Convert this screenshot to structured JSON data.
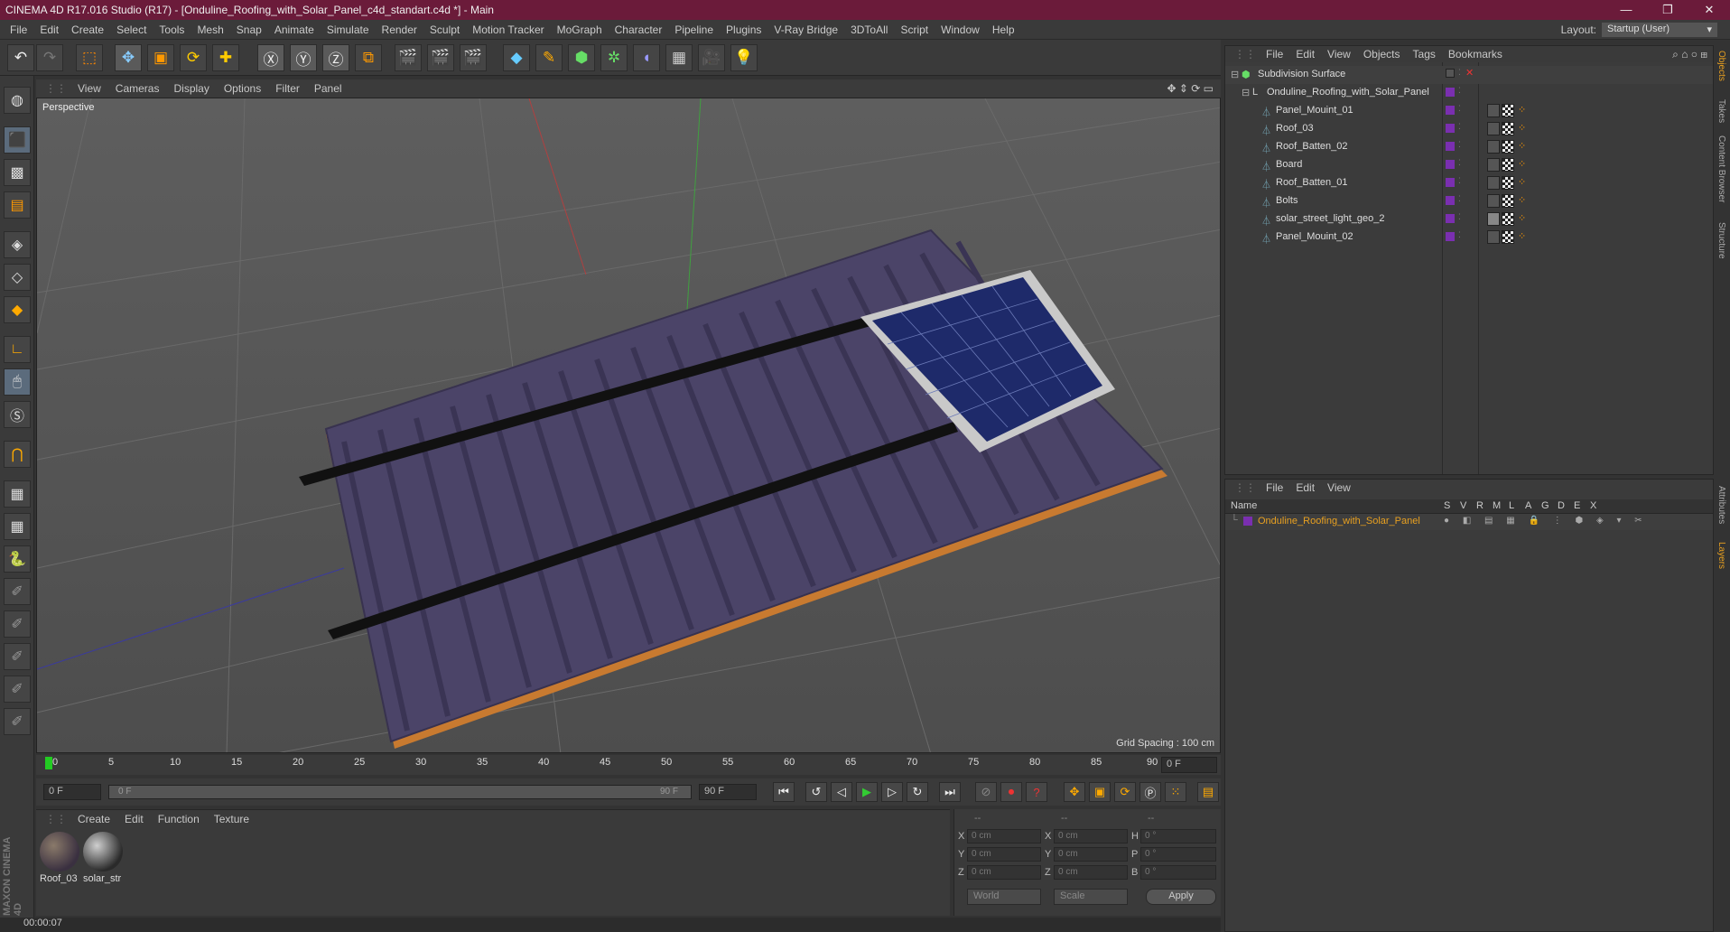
{
  "titlebar": {
    "title": "CINEMA 4D R17.016 Studio (R17) - [Onduline_Roofing_with_Solar_Panel_c4d_standart.c4d *] - Main",
    "minimize": "—",
    "maximize": "❐",
    "close": "✕"
  },
  "menubar": {
    "items": [
      "File",
      "Edit",
      "Create",
      "Select",
      "Tools",
      "Mesh",
      "Snap",
      "Animate",
      "Simulate",
      "Render",
      "Sculpt",
      "Motion Tracker",
      "MoGraph",
      "Character",
      "Pipeline",
      "Plugins",
      "V-Ray Bridge",
      "3DToAll",
      "Script",
      "Window",
      "Help"
    ],
    "layout_label": "Layout:",
    "layout_value": "Startup (User)"
  },
  "viewport": {
    "menu": [
      "View",
      "Cameras",
      "Display",
      "Options",
      "Filter",
      "Panel"
    ],
    "camera_label": "Perspective",
    "grid_spacing": "Grid Spacing : 100 cm"
  },
  "timeline": {
    "ticks": [
      "0",
      "5",
      "10",
      "15",
      "20",
      "25",
      "30",
      "35",
      "40",
      "45",
      "50",
      "55",
      "60",
      "65",
      "70",
      "75",
      "80",
      "85",
      "90"
    ],
    "current_frame_field": "0 F"
  },
  "time_controls": {
    "start_field": "0 F",
    "range_left": "0 F",
    "range_right": "90 F",
    "end_field": "90 F"
  },
  "material_panel": {
    "menu": [
      "Create",
      "Edit",
      "Function",
      "Texture"
    ],
    "materials": [
      {
        "label": "Roof_03"
      },
      {
        "label": "solar_str"
      }
    ]
  },
  "coords": {
    "header": [
      "--",
      "--",
      "--"
    ],
    "rows": [
      {
        "a": "X",
        "av": "0 cm",
        "b": "X",
        "bv": "0 cm",
        "c": "H",
        "cv": "0 °"
      },
      {
        "a": "Y",
        "av": "0 cm",
        "b": "Y",
        "bv": "0 cm",
        "c": "P",
        "cv": "0 °"
      },
      {
        "a": "Z",
        "av": "0 cm",
        "b": "Z",
        "bv": "0 cm",
        "c": "B",
        "cv": "0 °"
      }
    ],
    "world": "World",
    "scale": "Scale",
    "apply": "Apply"
  },
  "status": {
    "time": "00:00:07"
  },
  "object_manager": {
    "menu": [
      "File",
      "Edit",
      "View",
      "Objects",
      "Tags",
      "Bookmarks"
    ],
    "root": "Subdivision Surface",
    "group": "Onduline_Roofing_with_Solar_Panel",
    "children": [
      "Panel_Mouint_01",
      "Roof_03",
      "Roof_Batten_02",
      "Board",
      "Roof_Batten_01",
      "Bolts",
      "solar_street_light_geo_2",
      "Panel_Mouint_02"
    ]
  },
  "layer_manager": {
    "menu": [
      "File",
      "Edit",
      "View"
    ],
    "columns": [
      "Name",
      "S",
      "V",
      "R",
      "M",
      "L",
      "A",
      "G",
      "D",
      "E",
      "X"
    ],
    "layer_name": "Onduline_Roofing_with_Solar_Panel"
  },
  "side_tabs": [
    "Objects",
    "Takes",
    "Content Browser",
    "Structure",
    "Attributes",
    "Layers"
  ],
  "brand": "MAXON CINEMA 4D",
  "colors": {
    "titlebar": "#6b1b3a",
    "layer_highlight": "#e8a020",
    "purple_tag": "#7a2fb0",
    "roof": "#4b4468",
    "panel": "#1e2a6a"
  }
}
